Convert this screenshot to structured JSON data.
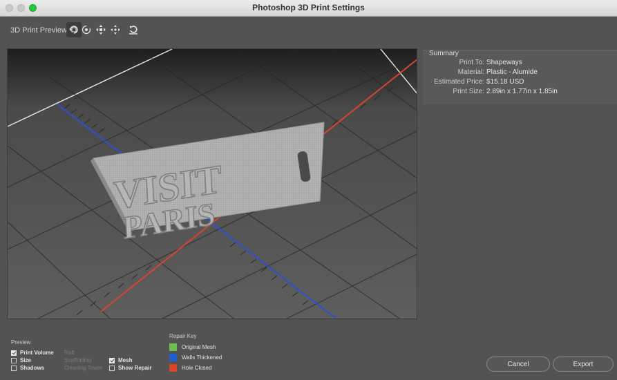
{
  "window": {
    "title": "Photoshop 3D Print Settings"
  },
  "toolbar": {
    "label": "3D Print Preview",
    "buttons": [
      {
        "icon": "orbit-icon",
        "active": true
      },
      {
        "icon": "roll-icon",
        "active": false
      },
      {
        "icon": "pan-icon",
        "active": false
      },
      {
        "icon": "slide-icon",
        "active": false
      },
      {
        "icon": "reset-view-icon",
        "active": false
      }
    ]
  },
  "summary": {
    "heading": "Summary",
    "rows": [
      {
        "key": "Print To:",
        "value": "Shapeways"
      },
      {
        "key": "Material:",
        "value": "Plastic - Alumide"
      },
      {
        "key": "Estimated Price:",
        "value": "$15.18 USD"
      },
      {
        "key": "Print Size:",
        "value": "2.89in x 1.77in x 1.85in"
      }
    ]
  },
  "preview": {
    "heading": "Preview",
    "options": {
      "print_volume": {
        "label": "Print Volume",
        "checked": true,
        "enabled": true
      },
      "size": {
        "label": "Size",
        "checked": false,
        "enabled": true
      },
      "shadows": {
        "label": "Shadows",
        "checked": false,
        "enabled": true
      },
      "raft": {
        "label": "Raft",
        "checked": false,
        "enabled": false
      },
      "scaffolding": {
        "label": "Scaffolding",
        "checked": false,
        "enabled": false
      },
      "cleaning_tower": {
        "label": "Cleaning Tower",
        "checked": false,
        "enabled": false
      },
      "mesh": {
        "label": "Mesh",
        "checked": true,
        "enabled": true
      },
      "show_repair": {
        "label": "Show Repair",
        "checked": false,
        "enabled": true
      }
    }
  },
  "repair_key": {
    "heading": "Repair Key",
    "items": [
      {
        "label": "Original Mesh",
        "color": "#6bbf4e"
      },
      {
        "label": "Walls Thickened",
        "color": "#1f5fd1"
      },
      {
        "label": "Hole Closed",
        "color": "#e0412a"
      }
    ]
  },
  "model": {
    "line1": "VISIT",
    "line2": "PARIS"
  },
  "buttons": {
    "cancel": "Cancel",
    "export": "Export"
  },
  "colors": {
    "axis_x": "#d8452e",
    "axis_y": "#2d4fd0"
  }
}
